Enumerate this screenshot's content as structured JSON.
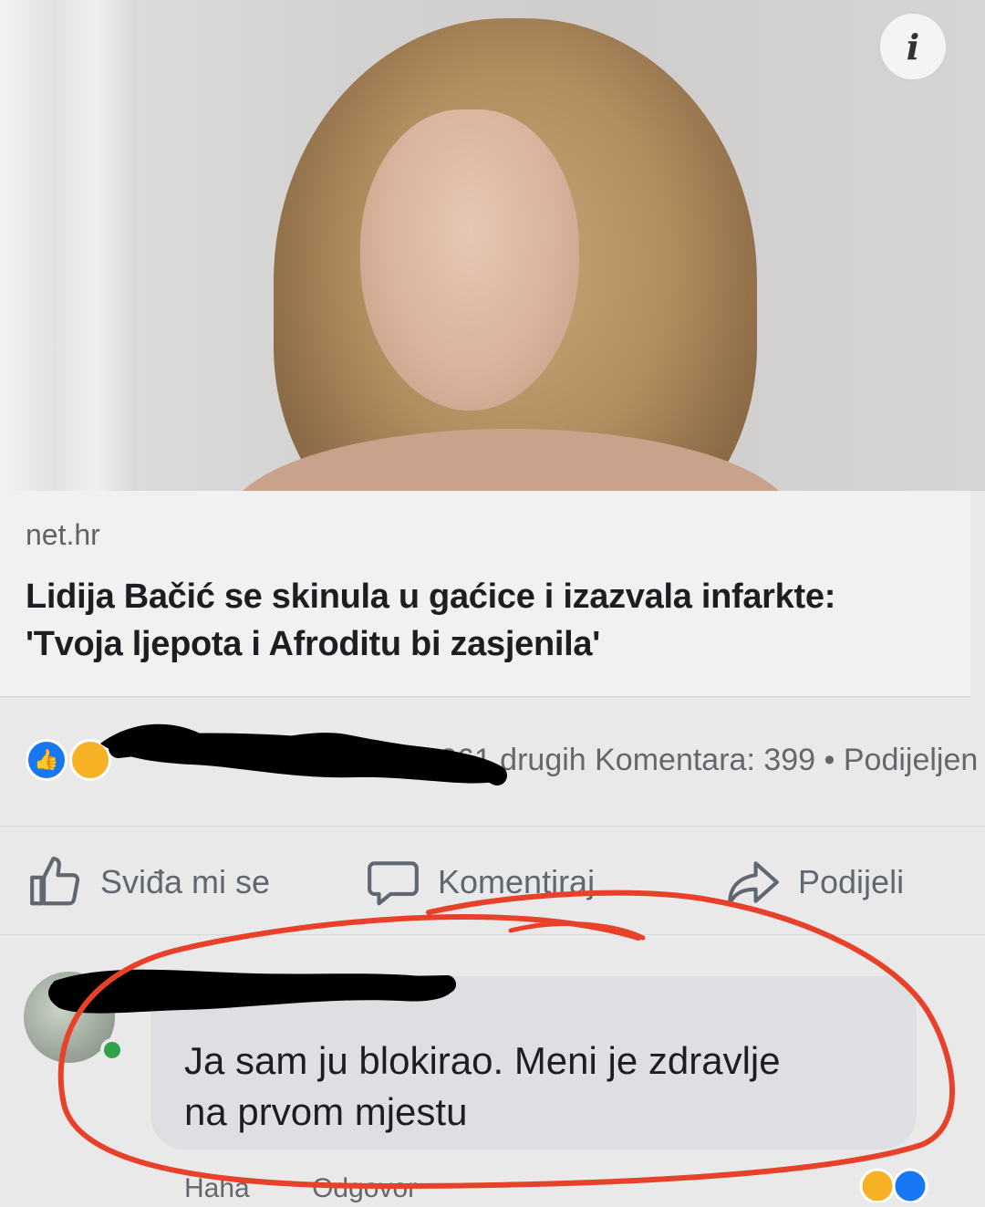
{
  "post": {
    "info_icon": "info-icon",
    "link": {
      "domain": "net.hr",
      "headline_line1": "Lidija Bačić se skinula u gaćice i izazvala infarkte:",
      "headline_line2": "'Tvoja ljepota i Afroditu bi zasjenila'"
    },
    "reactions": {
      "icons": [
        "like-icon",
        "haha-icon"
      ],
      "summary": "261 drugih Komentara: 399 • Podijeljen"
    },
    "actions": [
      {
        "label": "Sviđa mi se",
        "icon": "thumbs-up-icon"
      },
      {
        "label": "Komentiraj",
        "icon": "speech-bubble-icon"
      },
      {
        "label": "Podijeli",
        "icon": "share-arrow-icon"
      }
    ]
  },
  "comment": {
    "text_line1": "Ja sam ju blokirao. Meni je zdravlje",
    "text_line2": "na prvom mjestu",
    "footer": {
      "haha": "Haha",
      "reply": "Odgovor"
    }
  },
  "annotations": {
    "highlight_color": "#e8412a",
    "redaction_color": "#000000"
  }
}
